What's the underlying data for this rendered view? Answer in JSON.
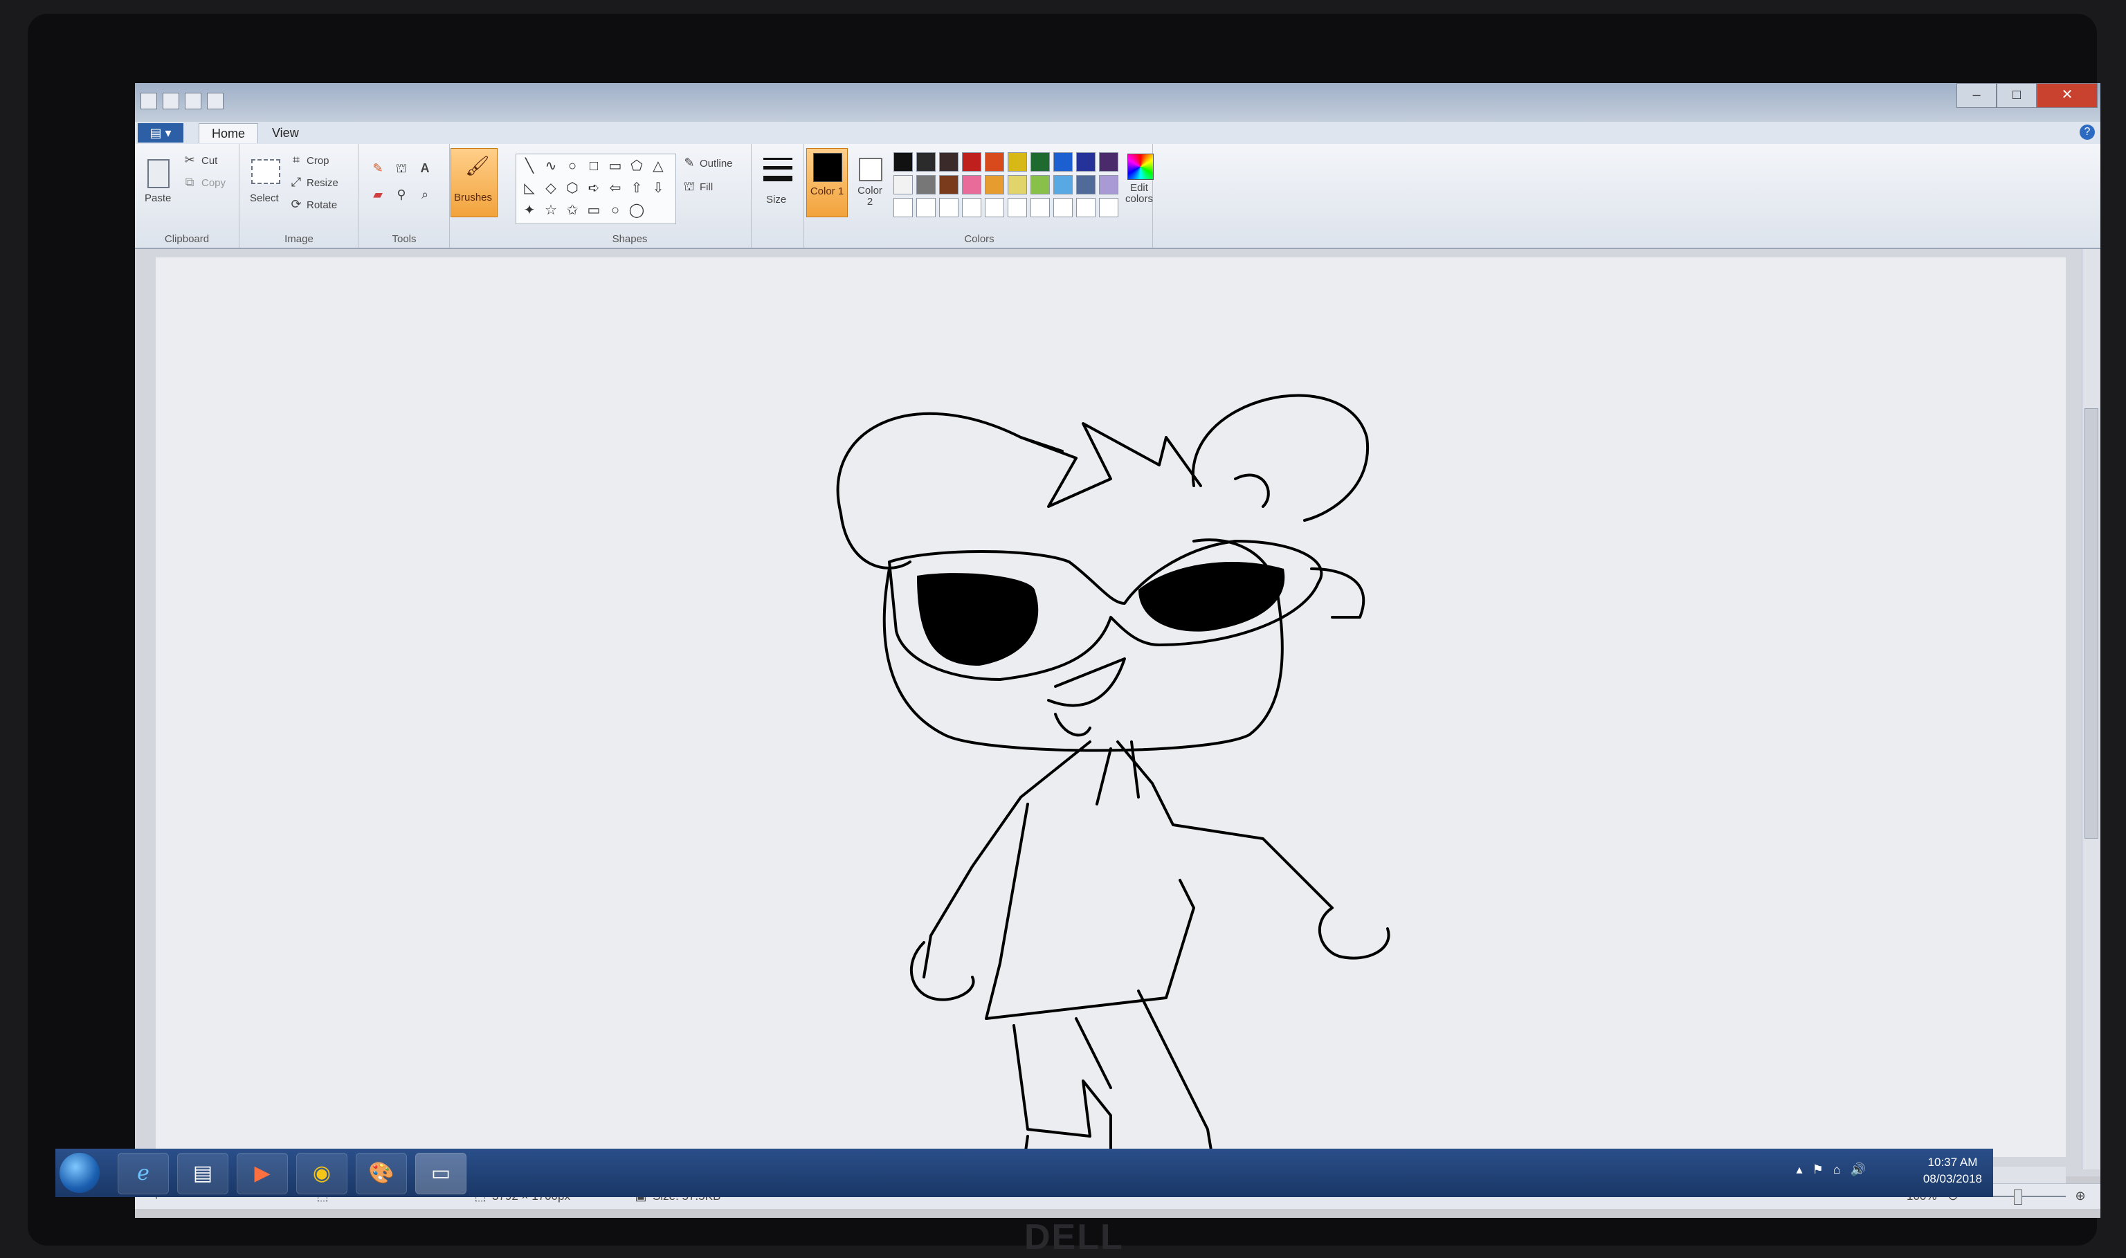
{
  "window": {
    "controls": {
      "minimize": "‒",
      "maximize": "□",
      "close": "✕"
    }
  },
  "tabs": {
    "file": "▤ ▾",
    "home": "Home",
    "view": "View",
    "help": "?"
  },
  "ribbon": {
    "clipboard": {
      "label": "Clipboard",
      "paste": "Paste",
      "cut": "Cut",
      "copy": "Copy"
    },
    "image": {
      "label": "Image",
      "select": "Select",
      "crop": "Crop",
      "resize": "Resize",
      "rotate": "Rotate"
    },
    "tools": {
      "label": "Tools",
      "brushes": "Brushes"
    },
    "shapes": {
      "label": "Shapes",
      "outline": "Outline",
      "fill": "Fill",
      "glyphs": [
        "╲",
        "∿",
        "○",
        "□",
        "▭",
        "⬠",
        "△",
        "◺",
        "◇",
        "⬡",
        "➪",
        "⇦",
        "⇧",
        "⇩",
        "✦",
        "☆",
        "✩",
        "▭",
        "○",
        "◯"
      ]
    },
    "size": {
      "label": "Size"
    },
    "colors": {
      "label": "Colors",
      "color1": "Color 1",
      "color2": "Color 2",
      "edit": "Edit colors",
      "row1": [
        "#111111",
        "#2b2b2b",
        "#3a2a2a",
        "#c0201d",
        "#d84a1c",
        "#d7b816",
        "#1f6b2f",
        "#1b5fd1",
        "#24329a",
        "#4a2a6a"
      ],
      "row2": [
        "#f2f2f2",
        "#777777",
        "#7a3b1d",
        "#e86b9a",
        "#e69c2e",
        "#e0d46a",
        "#88c04a",
        "#58a9e3",
        "#506a9a",
        "#a99ad6"
      ],
      "row3": [
        "#ffffff",
        "#ffffff",
        "#ffffff",
        "#ffffff",
        "#ffffff",
        "#ffffff",
        "#ffffff",
        "#ffffff",
        "#ffffff",
        "#ffffff"
      ]
    }
  },
  "status": {
    "dimensions": "3792 × 1700px",
    "size": "Size: 57.5KB",
    "zoom": "100%",
    "zoom_level": 0.5
  },
  "taskbar": {
    "time": "10:37 AM",
    "date": "08/03/2018"
  },
  "monitor": {
    "brand": "DELL"
  }
}
